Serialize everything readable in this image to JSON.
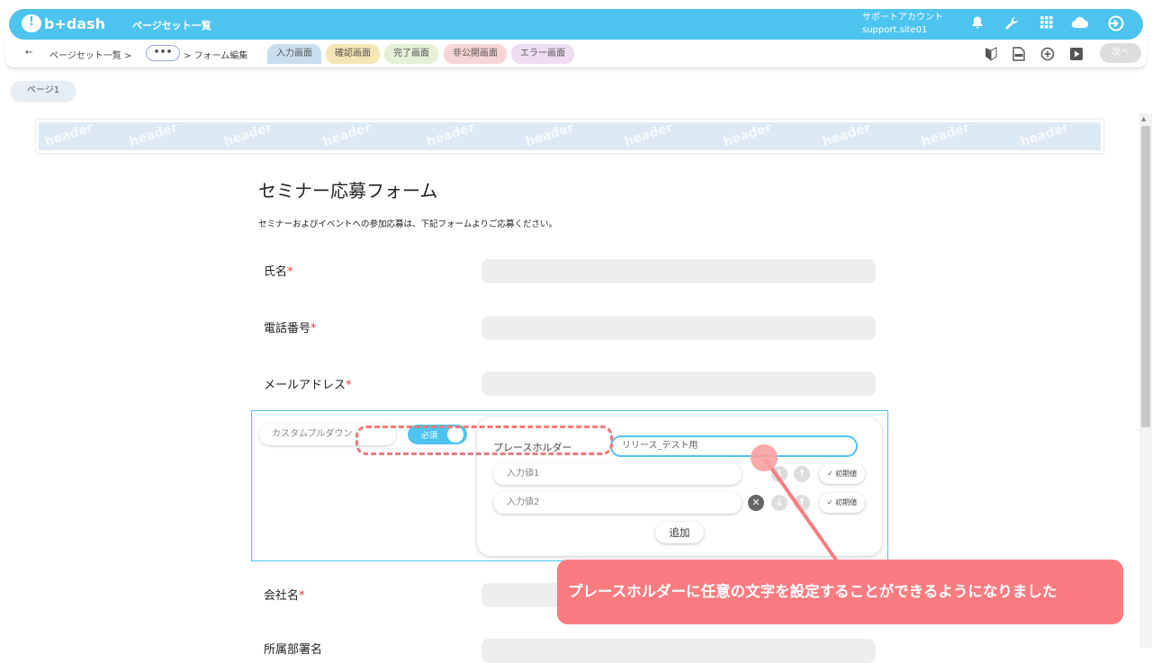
{
  "app": {
    "logo_text": "b+dash",
    "title": "ページセット一覧",
    "account_name": "サポートアカウント",
    "account_site": "support.site01"
  },
  "topbar_icons": [
    "bell-icon",
    "wrench-icon",
    "grid-icon",
    "cloud-icon",
    "logout-icon"
  ],
  "breadcrumb": {
    "back": "←",
    "item1": "ページセット一覧 >",
    "more": "•••",
    "item2": "> フォーム編集"
  },
  "tabs": [
    {
      "label": "入力画面",
      "color": "#c9dfef"
    },
    {
      "label": "確認画面",
      "color": "#f6e6b4"
    },
    {
      "label": "完了画面",
      "color": "#e4f1d8"
    },
    {
      "label": "非公開画面",
      "color": "#f8d6d6"
    },
    {
      "label": "エラー画面",
      "color": "#efdcf3"
    }
  ],
  "toolbar": {
    "next_label": "次へ"
  },
  "page_tab": "ページ1",
  "header_banner": {
    "watermark": "header"
  },
  "form": {
    "title": "セミナー応募フォーム",
    "description": "セミナーおよびイベントへの参加応募は、下記フォームよりご応募ください。",
    "required_mark": "*",
    "fields": [
      {
        "label": "氏名"
      },
      {
        "label": "電話番号"
      },
      {
        "label": "メールアドレス"
      },
      {
        "label": "会社名"
      },
      {
        "label": "所属部署名"
      }
    ]
  },
  "editor": {
    "item_name_placeholder": "カスタムプルダウン",
    "required_toggle": "必須",
    "placeholder_label": "プレースホルダー",
    "placeholder_value": "リリース_テスト用",
    "options": [
      {
        "placeholder": "入力値1",
        "default_label": "✓ 初期値"
      },
      {
        "placeholder": "入力値2",
        "default_label": "✓ 初期値"
      }
    ],
    "add_label": "追加"
  },
  "callout": {
    "text": "プレースホルダーに任意の文字を設定することができるようになりました"
  },
  "colors": {
    "brand": "#4dc4f0",
    "callout": "#fa7c80",
    "required": "#e53935"
  }
}
